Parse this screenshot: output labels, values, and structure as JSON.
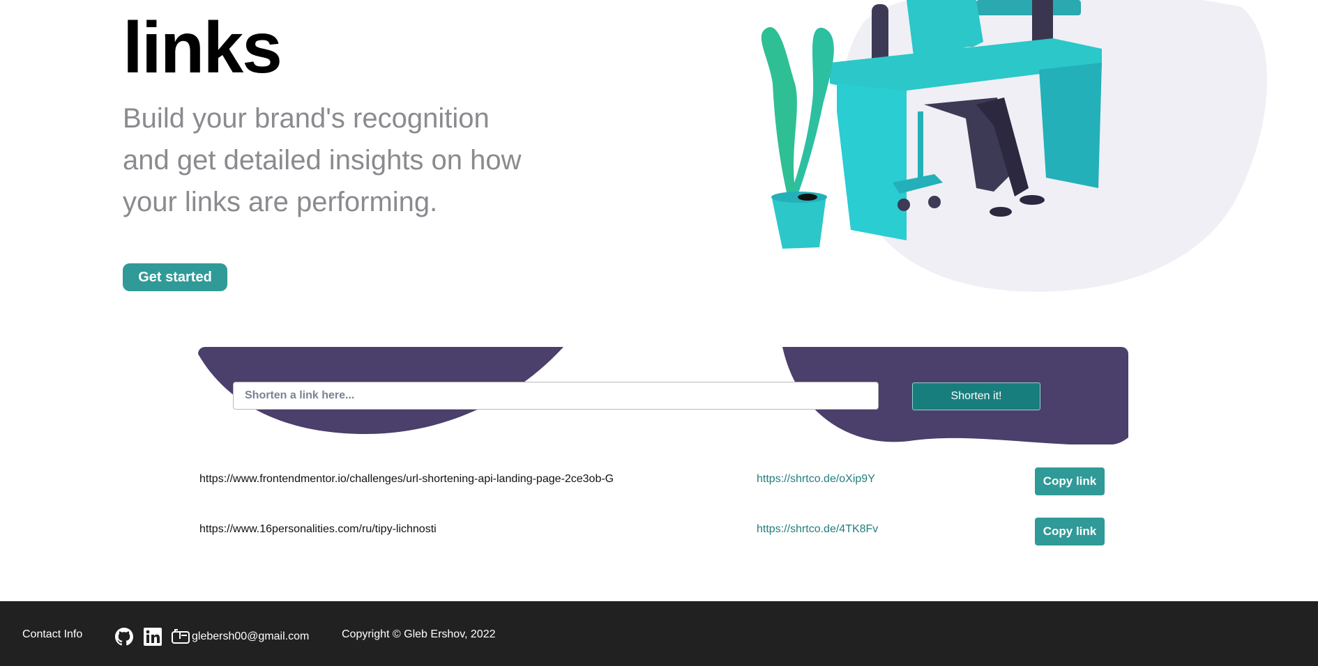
{
  "hero": {
    "title": "links",
    "subtitle": "Build your brand's recognition and get detailed insights on how your links are performing.",
    "cta_label": "Get started"
  },
  "shortener": {
    "input_placeholder": "Shorten a link here...",
    "button_label": "Shorten it!"
  },
  "results": [
    {
      "original": "https://www.frontendmentor.io/challenges/url-shortening-api-landing-page-2ce3ob-G",
      "short": "https://shrtco.de/oXip9Y",
      "copy_label": "Copy link"
    },
    {
      "original": "https://www.16personalities.com/ru/tipy-lichnosti",
      "short": "https://shrtco.de/4TK8Fv",
      "copy_label": "Copy link"
    }
  ],
  "footer": {
    "contact_label": "Contact Info",
    "email": "glebersh00@gmail.com",
    "copyright": "Copyright © Gleb Ershov, 2022",
    "icons": [
      "github-icon",
      "linkedin-icon",
      "mail-icon"
    ]
  },
  "colors": {
    "accent": "#2f9a97",
    "accent_dark": "#187e7d",
    "panel_purple": "#4b3f6b",
    "footer_bg": "#212121",
    "text_muted": "#8a8a8f"
  }
}
